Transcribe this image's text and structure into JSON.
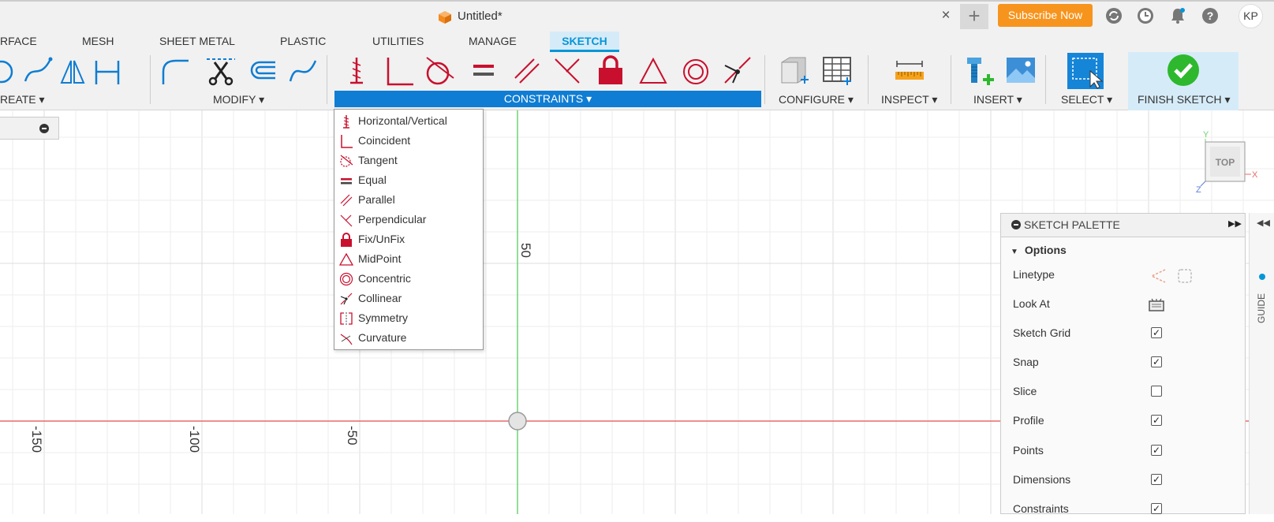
{
  "window": {
    "doc_title": "Untitled*",
    "close_glyph": "×",
    "new_tab_glyph": "+",
    "subscribe_label": "Subscribe Now",
    "user_initials": "KP"
  },
  "tabs": [
    "RFACE",
    "MESH",
    "SHEET METAL",
    "PLASTIC",
    "UTILITIES",
    "MANAGE",
    "SKETCH"
  ],
  "active_tab": "SKETCH",
  "ribbon": {
    "groups": {
      "create": "REATE ▾",
      "modify": "MODIFY ▾",
      "constraints": "CONSTRAINTS ▾",
      "configure": "CONFIGURE ▾",
      "inspect": "INSPECT ▾",
      "insert": "INSERT ▾",
      "select": "SELECT ▾",
      "finish": "FINISH SKETCH ▾"
    }
  },
  "constraints_menu": [
    {
      "label": "Horizontal/Vertical",
      "icon": "horizontal-vertical-icon"
    },
    {
      "label": "Coincident",
      "icon": "coincident-icon"
    },
    {
      "label": "Tangent",
      "icon": "tangent-icon"
    },
    {
      "label": "Equal",
      "icon": "equal-icon"
    },
    {
      "label": "Parallel",
      "icon": "parallel-icon"
    },
    {
      "label": "Perpendicular",
      "icon": "perpendicular-icon"
    },
    {
      "label": "Fix/UnFix",
      "icon": "lock-icon"
    },
    {
      "label": "MidPoint",
      "icon": "midpoint-icon"
    },
    {
      "label": "Concentric",
      "icon": "concentric-icon"
    },
    {
      "label": "Collinear",
      "icon": "collinear-icon"
    },
    {
      "label": "Symmetry",
      "icon": "symmetry-icon"
    },
    {
      "label": "Curvature",
      "icon": "curvature-icon"
    }
  ],
  "canvas": {
    "axis_labels": {
      "v50": "50",
      "h_neg150": "-150",
      "h_neg100": "-100",
      "h_neg50": "-50"
    }
  },
  "viewcube": {
    "face": "TOP",
    "x": "X",
    "y": "Y",
    "z": "Z"
  },
  "palette": {
    "title": "SKETCH PALETTE",
    "section": "Options",
    "rows": [
      {
        "label": "Linetype",
        "kind": "icons"
      },
      {
        "label": "Look At",
        "kind": "icon"
      },
      {
        "label": "Sketch Grid",
        "checked": true
      },
      {
        "label": "Snap",
        "checked": true
      },
      {
        "label": "Slice",
        "checked": false
      },
      {
        "label": "Profile",
        "checked": true
      },
      {
        "label": "Points",
        "checked": true
      },
      {
        "label": "Dimensions",
        "checked": true
      },
      {
        "label": "Constraints",
        "checked": true
      }
    ]
  },
  "side_panel": {
    "guide_label": "GUIDE"
  },
  "colors": {
    "accent": "#0696d7",
    "constraint_red": "#c8102e",
    "subscribe_orange": "#f7941d",
    "finish_green": "#2eb82e",
    "x_axis": "#e86a6a",
    "y_axis": "#6fd36f"
  }
}
